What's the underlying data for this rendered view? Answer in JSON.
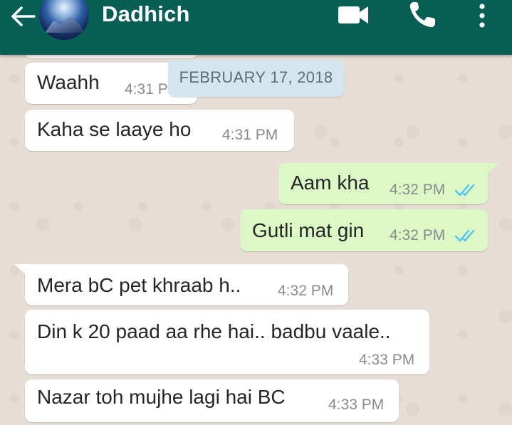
{
  "header": {
    "contact_name": "Dadhich",
    "back_icon": "arrow-left-icon",
    "avatar": "contact-avatar",
    "video_icon": "video-camera-icon",
    "call_icon": "phone-icon",
    "more_icon": "more-vertical-icon",
    "background_color": "#075e55"
  },
  "date_chip": {
    "label": "FEBRUARY 17, 2018"
  },
  "messages": [
    {
      "direction": "incoming",
      "text": "Waahh",
      "time": "4:31 PM"
    },
    {
      "direction": "incoming",
      "text": "Kaha se laaye ho",
      "time": "4:31 PM"
    },
    {
      "direction": "outgoing",
      "text": "Aam kha",
      "time": "4:32 PM",
      "status": "read"
    },
    {
      "direction": "outgoing",
      "text": "Gutli mat gin",
      "time": "4:32 PM",
      "status": "read"
    },
    {
      "direction": "incoming",
      "text": "Mera bC pet khraab h..",
      "time": "4:32 PM"
    },
    {
      "direction": "incoming",
      "text": "Din k 20 paad aa rhe hai.. badbu vaale..",
      "time": "4:33 PM"
    },
    {
      "direction": "incoming",
      "text": "Nazar toh mujhe lagi hai BC",
      "time": "4:33 PM"
    }
  ],
  "colors": {
    "incoming_bubble": "#ffffff",
    "outgoing_bubble": "#dcf8c6",
    "read_ticks": "#4fc3f7",
    "chat_background": "#e6ded5"
  }
}
